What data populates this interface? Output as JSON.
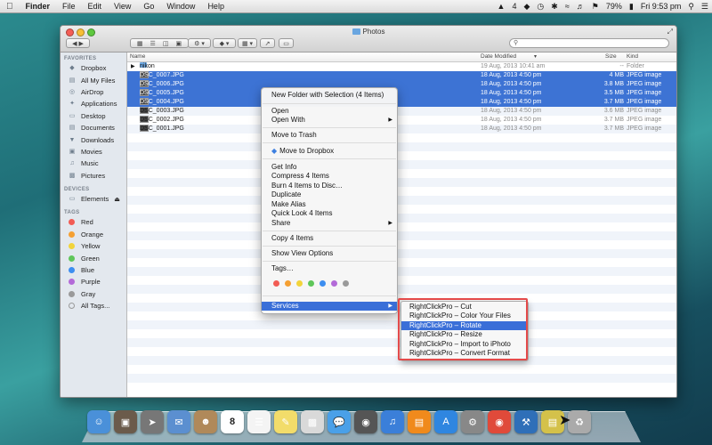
{
  "menubar": {
    "app": "Finder",
    "menus": [
      "File",
      "Edit",
      "View",
      "Go",
      "Window",
      "Help"
    ],
    "status_right": [
      "4",
      "79%",
      "Fri 9:53 pm"
    ]
  },
  "window": {
    "title": "Photos",
    "search_placeholder": ""
  },
  "sidebar": {
    "favorites_header": "FAVORITES",
    "favorites": [
      {
        "label": "Dropbox",
        "icon": "dropbox-icon"
      },
      {
        "label": "All My Files",
        "icon": "all-files-icon"
      },
      {
        "label": "AirDrop",
        "icon": "airdrop-icon"
      },
      {
        "label": "Applications",
        "icon": "applications-icon"
      },
      {
        "label": "Desktop",
        "icon": "desktop-icon"
      },
      {
        "label": "Documents",
        "icon": "documents-icon"
      },
      {
        "label": "Downloads",
        "icon": "downloads-icon"
      },
      {
        "label": "Movies",
        "icon": "movies-icon"
      },
      {
        "label": "Music",
        "icon": "music-icon"
      },
      {
        "label": "Pictures",
        "icon": "pictures-icon"
      }
    ],
    "devices_header": "DEVICES",
    "devices": [
      {
        "label": "Elements",
        "icon": "drive-icon"
      }
    ],
    "tags_header": "TAGS",
    "tags": [
      {
        "label": "Red",
        "color": "#f25c54"
      },
      {
        "label": "Orange",
        "color": "#f5a032"
      },
      {
        "label": "Yellow",
        "color": "#f2d43a"
      },
      {
        "label": "Green",
        "color": "#5fc65a"
      },
      {
        "label": "Blue",
        "color": "#3d8ef0"
      },
      {
        "label": "Purple",
        "color": "#b36ad8"
      },
      {
        "label": "Gray",
        "color": "#9a9a9a"
      },
      {
        "label": "All Tags...",
        "color": ""
      }
    ]
  },
  "list": {
    "columns": {
      "name": "Name",
      "date": "Date Modified",
      "size": "Size",
      "kind": "Kind"
    },
    "rows": [
      {
        "name": "nikon",
        "date": "19 Aug, 2013 10:41 am",
        "size": "--",
        "kind": "Folder",
        "selected": false,
        "folder": true
      },
      {
        "name": "DSC_0007.JPG",
        "date": "18 Aug, 2013 4:50 pm",
        "size": "4 MB",
        "kind": "JPEG image",
        "selected": true,
        "folder": false
      },
      {
        "name": "DSC_0006.JPG",
        "date": "18 Aug, 2013 4:50 pm",
        "size": "3.8 MB",
        "kind": "JPEG image",
        "selected": true,
        "folder": false
      },
      {
        "name": "DSC_0005.JPG",
        "date": "18 Aug, 2013 4:50 pm",
        "size": "3.5 MB",
        "kind": "JPEG image",
        "selected": true,
        "folder": false
      },
      {
        "name": "DSC_0004.JPG",
        "date": "18 Aug, 2013 4:50 pm",
        "size": "3.7 MB",
        "kind": "JPEG image",
        "selected": true,
        "folder": false
      },
      {
        "name": "DSC_0003.JPG",
        "date": "18 Aug, 2013 4:50 pm",
        "size": "3.6 MB",
        "kind": "JPEG image",
        "selected": false,
        "folder": false
      },
      {
        "name": "DSC_0002.JPG",
        "date": "18 Aug, 2013 4:50 pm",
        "size": "3.7 MB",
        "kind": "JPEG image",
        "selected": false,
        "folder": false
      },
      {
        "name": "DSC_0001.JPG",
        "date": "18 Aug, 2013 4:50 pm",
        "size": "3.7 MB",
        "kind": "JPEG image",
        "selected": false,
        "folder": false
      }
    ]
  },
  "context_menu": {
    "new_folder": "New Folder with Selection (4 Items)",
    "open": "Open",
    "open_with": "Open With",
    "move_to_trash": "Move to Trash",
    "move_to_dropbox": "Move to Dropbox",
    "get_info": "Get Info",
    "compress": "Compress 4 Items",
    "burn": "Burn 4 Items to Disc…",
    "duplicate": "Duplicate",
    "make_alias": "Make Alias",
    "quick_look": "Quick Look 4 Items",
    "share": "Share",
    "copy": "Copy 4 Items",
    "show_view_options": "Show View Options",
    "tags": "Tags…",
    "tag_colors": [
      "#f25c54",
      "#f5a032",
      "#f2d43a",
      "#5fc65a",
      "#3d8ef0",
      "#b36ad8",
      "#9a9a9a"
    ],
    "services": "Services"
  },
  "services_menu": [
    "RightClickPro – Cut",
    "RightClickPro – Color Your Files",
    "RightClickPro – Rotate",
    "RightClickPro – Resize",
    "RightClickPro – Import to iPhoto",
    "RightClickPro – Convert Format"
  ],
  "dock": {
    "date_badge": "8",
    "items": [
      {
        "icon": "finder-icon",
        "color": "#4a90d9"
      },
      {
        "icon": "screenshot-icon",
        "color": "#6b5b4b"
      },
      {
        "icon": "launchpad-icon",
        "color": "#777"
      },
      {
        "icon": "mail-stamp-icon",
        "color": "#5b8fd0"
      },
      {
        "icon": "contacts-icon",
        "color": "#b0895a"
      },
      {
        "icon": "calendar-icon",
        "color": "#ffffff"
      },
      {
        "icon": "reminders-icon",
        "color": "#f4f4f4"
      },
      {
        "icon": "notes-icon",
        "color": "#f2dc6a"
      },
      {
        "icon": "preview-icon",
        "color": "#d9d9d9"
      },
      {
        "icon": "messages-icon",
        "color": "#4aa0e8"
      },
      {
        "icon": "facetime-icon",
        "color": "#555"
      },
      {
        "icon": "itunes-icon",
        "color": "#3b7fd9"
      },
      {
        "icon": "ibooks-icon",
        "color": "#f08a1c"
      },
      {
        "icon": "app-store-icon",
        "color": "#2f86e0"
      },
      {
        "icon": "system-preferences-icon",
        "color": "#888"
      },
      {
        "icon": "chrome-icon",
        "color": "#e04a3a"
      },
      {
        "icon": "xcode-icon",
        "color": "#2f6fb8"
      },
      {
        "icon": "notes-stack-icon",
        "color": "#d4c14a"
      },
      {
        "icon": "trash-icon",
        "color": "#aaa"
      }
    ]
  }
}
